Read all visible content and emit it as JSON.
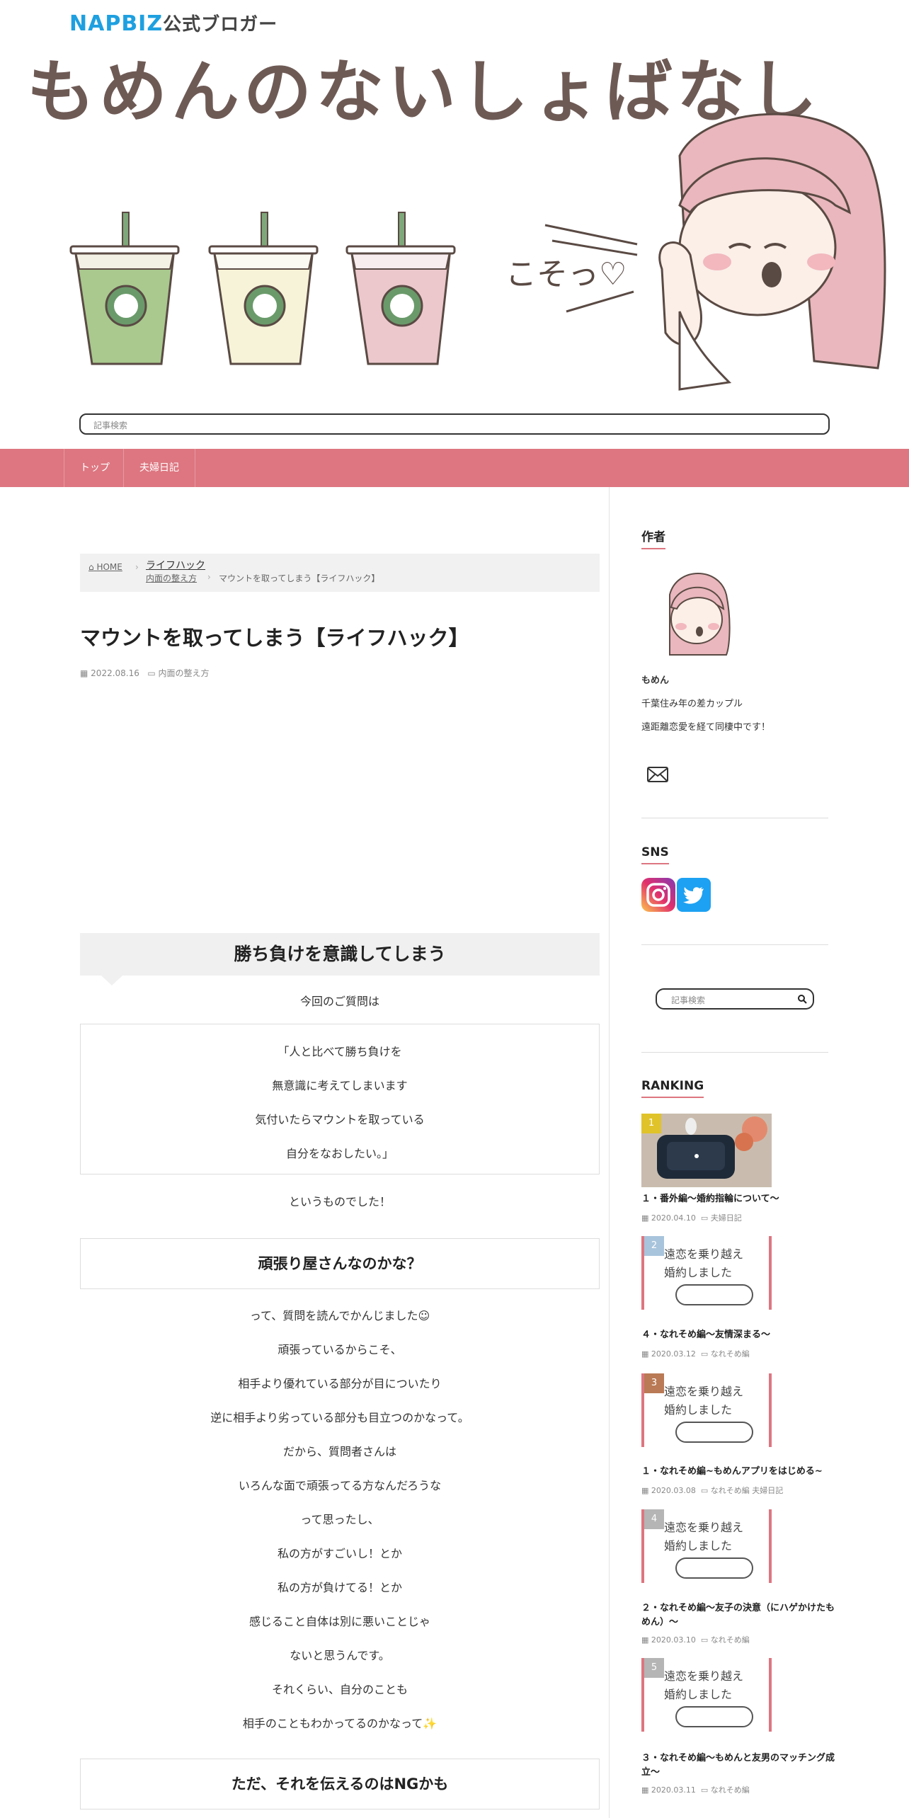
{
  "header": {
    "brand_nap": "NAPBIZ",
    "brand_rest": "公式ブロガー",
    "site_title": "もめんのないしょばなし",
    "search_placeholder": "記事検索",
    "illust_text": "こそっ♡"
  },
  "nav": {
    "items": [
      "トップ",
      "夫婦日記"
    ]
  },
  "breadcrumb": {
    "home": "HOME",
    "level1": "ライフハック",
    "level2": "内面の整え方",
    "current": "マウントを取ってしまう【ライフハック】"
  },
  "post": {
    "title": "マウントを取ってしまう【ライフハック】",
    "date": "2022.08.16",
    "category": "内面の整え方",
    "h2": "勝ち負けを意識してしまう",
    "intro": "今回のご質問は",
    "quote": [
      "「人と比べて勝ち負けを",
      "無意識に考えてしまいます",
      "気付いたらマウントを取っている",
      "自分をなおしたい。」"
    ],
    "after_quote": "というものでした！",
    "h3_1": "頑張り屋さんなのかな？",
    "body": [
      "って、質問を読んでかんじました☺",
      "頑張っているからこそ、",
      "相手より優れている部分が目についたり",
      "逆に相手より劣っている部分も目立つのかなって。",
      "だから、質問者さんは",
      "いろんな面で頑張ってる方なんだろうな",
      "って思ったし、",
      "私の方がすごいし！とか",
      "私の方が負けてる！とか",
      "感じること自体は別に悪いことじゃ",
      "ないと思うんです。",
      "それくらい、自分のことも",
      "相手のこともわかってるのかなって✨"
    ],
    "h3_2": "ただ、それを伝えるのはNGかも"
  },
  "sidebar": {
    "author_heading": "作者",
    "author_name": "もめん",
    "author_desc1": "千葉住み年の差カップル",
    "author_desc2": "遠距離恋愛を経て同棲中です！",
    "sns_heading": "SNS",
    "search_placeholder": "記事検索",
    "ranking_heading": "RANKING",
    "ranking": [
      {
        "rank": "1",
        "title": "１・番外編～婚約指輪について～",
        "date": "2020.04.10",
        "cats": "夫婦日記"
      },
      {
        "rank": "2",
        "title": "４・なれそめ編～友情深まる～",
        "date": "2020.03.12",
        "cats": "なれそめ編"
      },
      {
        "rank": "3",
        "title": "１・なれそめ編~もめんアプリをはじめる~",
        "date": "2020.03.08",
        "cats": "なれそめ編  夫婦日記"
      },
      {
        "rank": "4",
        "title": "２・なれそめ編～友子の決意（にハゲかけたもめん）～",
        "date": "2020.03.10",
        "cats": "なれそめ編"
      },
      {
        "rank": "5",
        "title": "３・なれそめ編～もめんと友男のマッチング成立～",
        "date": "2020.03.11",
        "cats": "なれそめ編"
      }
    ],
    "thumb_text": [
      "遠恋を乗り越え",
      "婚約しました"
    ]
  },
  "colors": {
    "accent": "#dd7680",
    "brand_blue": "#1ea0e0"
  }
}
